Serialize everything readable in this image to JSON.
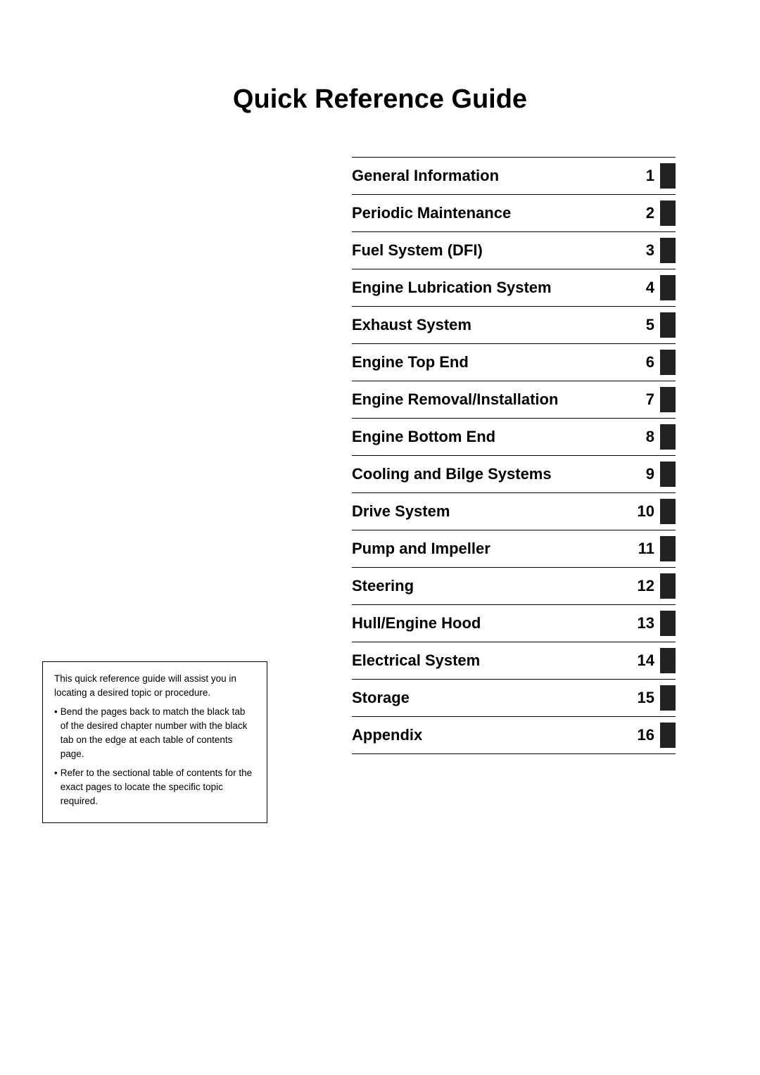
{
  "page": {
    "title": "Quick Reference Guide",
    "toc": {
      "items": [
        {
          "label": "General Information",
          "number": "1"
        },
        {
          "label": "Periodic Maintenance",
          "number": "2"
        },
        {
          "label": "Fuel System (DFI)",
          "number": "3"
        },
        {
          "label": "Engine Lubrication System",
          "number": "4"
        },
        {
          "label": "Exhaust System",
          "number": "5"
        },
        {
          "label": "Engine Top End",
          "number": "6"
        },
        {
          "label": "Engine Removal/Installation",
          "number": "7"
        },
        {
          "label": "Engine Bottom End",
          "number": "8"
        },
        {
          "label": "Cooling and Bilge Systems",
          "number": "9"
        },
        {
          "label": "Drive System",
          "number": "10"
        },
        {
          "label": "Pump and Impeller",
          "number": "11"
        },
        {
          "label": "Steering",
          "number": "12"
        },
        {
          "label": "Hull/Engine Hood",
          "number": "13"
        },
        {
          "label": "Electrical System",
          "number": "14"
        },
        {
          "label": "Storage",
          "number": "15"
        },
        {
          "label": "Appendix",
          "number": "16"
        }
      ]
    },
    "info_box": {
      "intro": "This quick reference guide will assist you in locating a desired topic or procedure.",
      "bullet1": "Bend the pages back to match the black tab of the desired chapter number with the black tab on the edge at each table of contents page.",
      "bullet2": "Refer to the sectional table of contents for the exact pages to locate the specific topic required."
    }
  }
}
